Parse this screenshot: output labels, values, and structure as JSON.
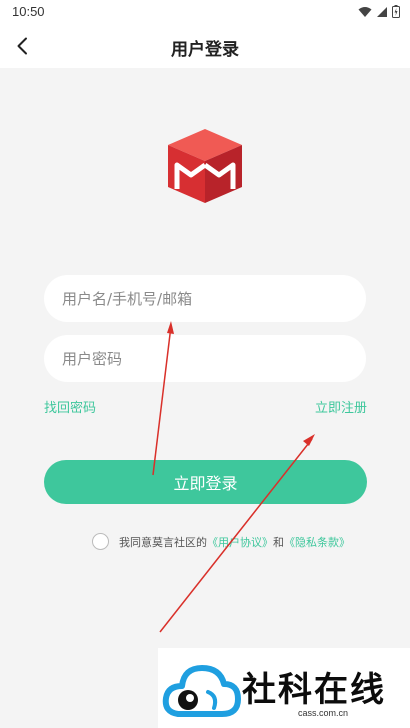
{
  "status_bar": {
    "time": "10:50"
  },
  "header": {
    "title": "用户登录"
  },
  "form": {
    "username_placeholder": "用户名/手机号/邮箱",
    "password_placeholder": "用户密码",
    "forgot_label": "找回密码",
    "register_label": "立即注册",
    "login_label": "立即登录"
  },
  "agreement": {
    "prefix": "我同意莫言社区的",
    "user_agreement": "《用户协议》",
    "conjunction": "和",
    "privacy_terms": "《隐私条款》",
    "checked": false
  },
  "watermark": {
    "name": "社科在线",
    "site": "cass.com.cn"
  },
  "colors": {
    "accent": "#3ec79c",
    "logo": "#e0393a",
    "annotation": "#d9302a"
  }
}
